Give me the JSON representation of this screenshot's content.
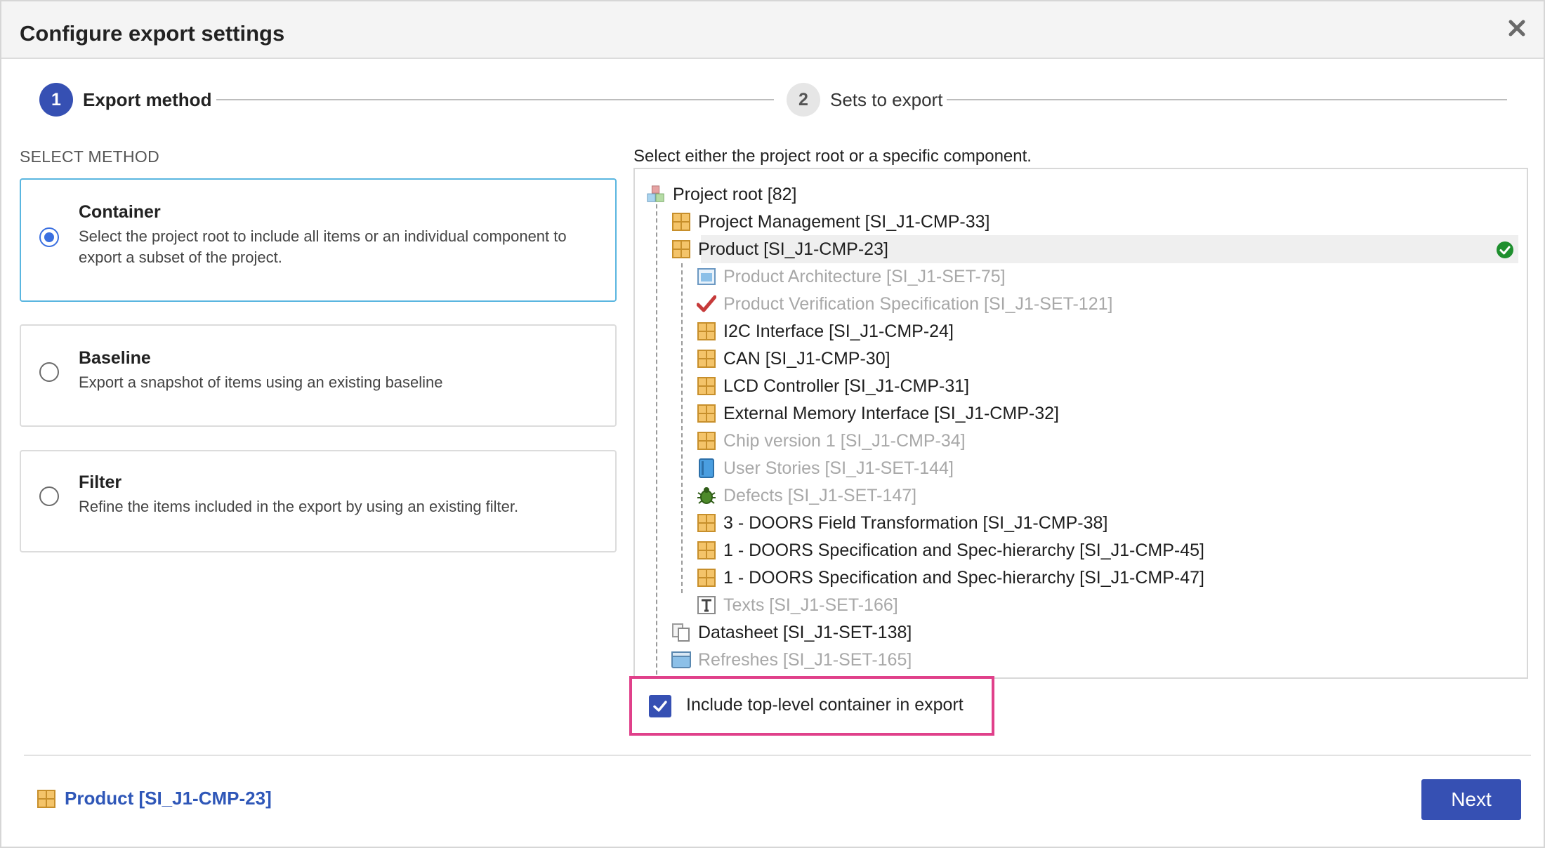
{
  "dialog": {
    "title": "Configure export settings",
    "close_icon": "close-icon"
  },
  "stepper": {
    "steps": [
      {
        "number": "1",
        "label": "Export method",
        "active": true
      },
      {
        "number": "2",
        "label": "Sets to export",
        "active": false
      }
    ]
  },
  "methods": {
    "heading": "SELECT METHOD",
    "options": [
      {
        "title": "Container",
        "description": "Select the project root to include all items or an individual component to export a subset of the project.",
        "selected": true
      },
      {
        "title": "Baseline",
        "description": "Export a snapshot of items using an existing baseline",
        "selected": false
      },
      {
        "title": "Filter",
        "description": "Refine the items included in the export by using an existing filter.",
        "selected": false
      }
    ]
  },
  "tree": {
    "prompt": "Select either the project root or a specific component.",
    "items": [
      {
        "label": "Project root [82]",
        "icon": "project-root-icon",
        "enabled": true
      },
      {
        "label": "Project Management [SI_J1-CMP-33]",
        "icon": "component-icon",
        "enabled": true
      },
      {
        "label": "Product [SI_J1-CMP-23]",
        "icon": "component-icon",
        "enabled": true,
        "selected": true
      },
      {
        "label": "Product Architecture [SI_J1-SET-75]",
        "icon": "architecture-set-icon",
        "enabled": false
      },
      {
        "label": "Product Verification Specification [SI_J1-SET-121]",
        "icon": "verification-check-icon",
        "enabled": false
      },
      {
        "label": "I2C Interface [SI_J1-CMP-24]",
        "icon": "component-icon",
        "enabled": true
      },
      {
        "label": "CAN [SI_J1-CMP-30]",
        "icon": "component-icon",
        "enabled": true
      },
      {
        "label": "LCD Controller [SI_J1-CMP-31]",
        "icon": "component-icon",
        "enabled": true
      },
      {
        "label": "External Memory Interface [SI_J1-CMP-32]",
        "icon": "component-icon",
        "enabled": true
      },
      {
        "label": "Chip version 1 [SI_J1-CMP-34]",
        "icon": "component-icon",
        "enabled": false
      },
      {
        "label": "User Stories [SI_J1-SET-144]",
        "icon": "user-stories-icon",
        "enabled": false
      },
      {
        "label": "Defects [SI_J1-SET-147]",
        "icon": "bug-icon",
        "enabled": false
      },
      {
        "label": "3 - DOORS Field Transformation [SI_J1-CMP-38]",
        "icon": "component-icon",
        "enabled": true
      },
      {
        "label": "1 - DOORS Specification and Spec-hierarchy [SI_J1-CMP-45]",
        "icon": "component-icon",
        "enabled": true
      },
      {
        "label": "1 - DOORS Specification and Spec-hierarchy [SI_J1-CMP-47]",
        "icon": "component-icon",
        "enabled": true
      },
      {
        "label": "Texts [SI_J1-SET-166]",
        "icon": "text-icon",
        "enabled": false
      },
      {
        "label": "Datasheet [SI_J1-SET-138]",
        "icon": "documents-icon",
        "enabled": true
      },
      {
        "label": "Refreshes [SI_J1-SET-165]",
        "icon": "window-icon",
        "enabled": false
      }
    ]
  },
  "include_container": {
    "label": "Include top-level container in export",
    "checked": true
  },
  "footer": {
    "selection_label": "Product [SI_J1-CMP-23]",
    "next_label": "Next"
  },
  "colors": {
    "primary": "#3650b3",
    "selected_border": "#5ab6e0",
    "highlight": "#e0408a",
    "link": "#2f57b8",
    "disabled_text": "#a8a8a8",
    "success": "#1e8f2e"
  }
}
